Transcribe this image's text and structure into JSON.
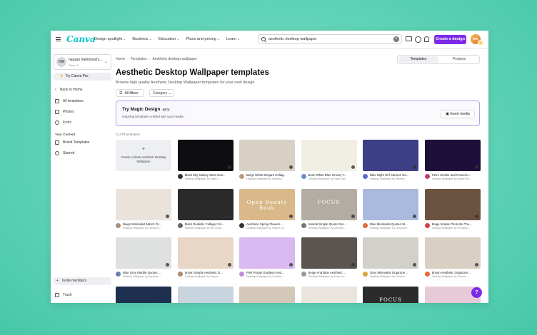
{
  "app": {
    "logo": "Canva"
  },
  "nav": [
    {
      "label": "Design spotlight"
    },
    {
      "label": "Business"
    },
    {
      "label": "Education"
    },
    {
      "label": "Plans and pricing"
    },
    {
      "label": "Learn"
    }
  ],
  "search": {
    "value": "aesthetic desktop wallpaper",
    "placeholder": "Search"
  },
  "topbar": {
    "create_label": "Create a design",
    "avatar_initials": "hm"
  },
  "sidebar": {
    "account_name": "hassan mehmood's...",
    "account_sub": "Free • 1",
    "account_initials": "HM",
    "try_pro": "Try Canva Pro",
    "items": [
      {
        "label": "Back to Home"
      },
      {
        "label": "All templates"
      },
      {
        "label": "Photos"
      },
      {
        "label": "Icons"
      }
    ],
    "section_title": "Your Content",
    "content_items": [
      {
        "label": "Brand Templates"
      },
      {
        "label": "Starred"
      }
    ],
    "invite": "Invite members",
    "trash": "Trash"
  },
  "breadcrumb": {
    "home": "Home",
    "templates": "Templates",
    "current": "Aesthetic desktop wallpaper"
  },
  "toggle": {
    "templates": "Templates",
    "projects": "Projects"
  },
  "page": {
    "title": "Aesthetic Desktop Wallpaper templates",
    "subtitle": "Browse high quality Aesthetic Desktop Wallpaper templates for your next design",
    "filters_label": "All filters",
    "category_label": "Category",
    "count": "11,378 templates"
  },
  "magic": {
    "title": "Try Magic Design",
    "beta": "BETA",
    "subtitle": "Inspiring templates crafted with your media.",
    "button": "Insert media"
  },
  "blank": {
    "plus": "+",
    "label": "Create a blank Aesthetic Desktop Wallpaper"
  },
  "cards": [
    {
      "name": "Black Sky Galaxy Stars Des...",
      "by": "Desktop Wallpaper by Salah I...",
      "bg": "#0d0d12",
      "av": "#333"
    },
    {
      "name": "Beige White Elegant Collag...",
      "by": "Desktop Wallpaper by Stephan...",
      "bg": "#d9d0c5",
      "av": "#b79a7e"
    },
    {
      "name": "Bone White Blue Groovy Y...",
      "by": "Desktop Wallpaper by Think Sym",
      "bg": "#f1eee4",
      "av": "#6a8cc9"
    },
    {
      "name": "Blue Night Girl Cartoon De...",
      "by": "Desktop Wallpaper by Tekenin...",
      "bg": "#3d3f86",
      "av": "#5a6ad0"
    },
    {
      "name": "Retro Smoke and Round Li...",
      "by": "Desktop Wallpaper by Kaiseri Wi...",
      "bg": "#1c0f3a",
      "av": "#c43a7a"
    },
    {
      "name": "Beige Minimalist March Or...",
      "by": "Desktop Wallpaper by Hanna D...",
      "bg": "#e9e3dc",
      "av": "#a98e78"
    },
    {
      "name": "Black Realistic Collage Col...",
      "by": "Desktop Wallpaper by Nic Creat...",
      "bg": "#2a2a2a",
      "av": "#666"
    },
    {
      "name": "Aesthetic Spring Flowers ...",
      "by": "Desktop Wallpaper by Hanni K D...",
      "bg": "#d9b88a",
      "av": "#333"
    },
    {
      "name": "Neutral Simple Quote Des...",
      "by": "Desktop Wallpaper by LyFlonts...",
      "bg": "#b3aca3",
      "av": "#777"
    },
    {
      "name": "Blue Minimalist Quotes W...",
      "by": "Desktop Wallpaper by Lemonme...",
      "bg": "#aab9de",
      "av": "#e06b3a"
    },
    {
      "name": "Beige Simple Photo Be The...",
      "by": "Desktop Wallpaper by VFfodesi...",
      "bg": "#6b5240",
      "av": "#c44"
    },
    {
      "name": "Blue Grey Marble Quotes ...",
      "by": "Desktop Wallpaper by Sophida...",
      "bg": "#dfe0e0",
      "av": "#6b7fb0"
    },
    {
      "name": "Brown Simple Aesthetic D...",
      "by": "Desktop Wallpaper by Naryaa",
      "bg": "#e8d6c6",
      "av": "#b08a6a"
    },
    {
      "name": "Pink Purple Gradient Aest...",
      "by": "Desktop Wallpaper by Creative ...",
      "bg": "#d9b9f0",
      "av": "#c08ce0"
    },
    {
      "name": "Beige And Blue Aesthetic ...",
      "by": "Desktop Wallpaper by Anna Cre...",
      "bg": "#5a5550",
      "av": "#999"
    },
    {
      "name": "Grey Minimalist Organizer ...",
      "by": "Desktop Wallpaper by Hemeni...",
      "bg": "#d2d0ca",
      "av": "#e0a040"
    },
    {
      "name": "Brown Aesthetic Organizer...",
      "by": "Desktop Wallpaper by Hemeni...",
      "bg": "#d9cfc2",
      "av": "#e06b3a"
    },
    {
      "name": "",
      "by": "",
      "bg": "#1e3050",
      "av": "#555"
    },
    {
      "name": "",
      "by": "",
      "bg": "#c8d4de",
      "av": "#555"
    },
    {
      "name": "",
      "by": "",
      "bg": "#d6c8b8",
      "av": "#555"
    },
    {
      "name": "",
      "by": "",
      "bg": "#e9e4dd",
      "av": "#555"
    },
    {
      "name": "",
      "by": "",
      "bg": "#2b2b2b",
      "av": "#555"
    },
    {
      "name": "",
      "by": "",
      "bg": "#e7c9d8",
      "av": "#555"
    }
  ],
  "thumb_text": {
    "c7": "Open Beauty Book",
    "c8": "FOCUS",
    "c21": "FOCUS"
  },
  "help_label": "?"
}
